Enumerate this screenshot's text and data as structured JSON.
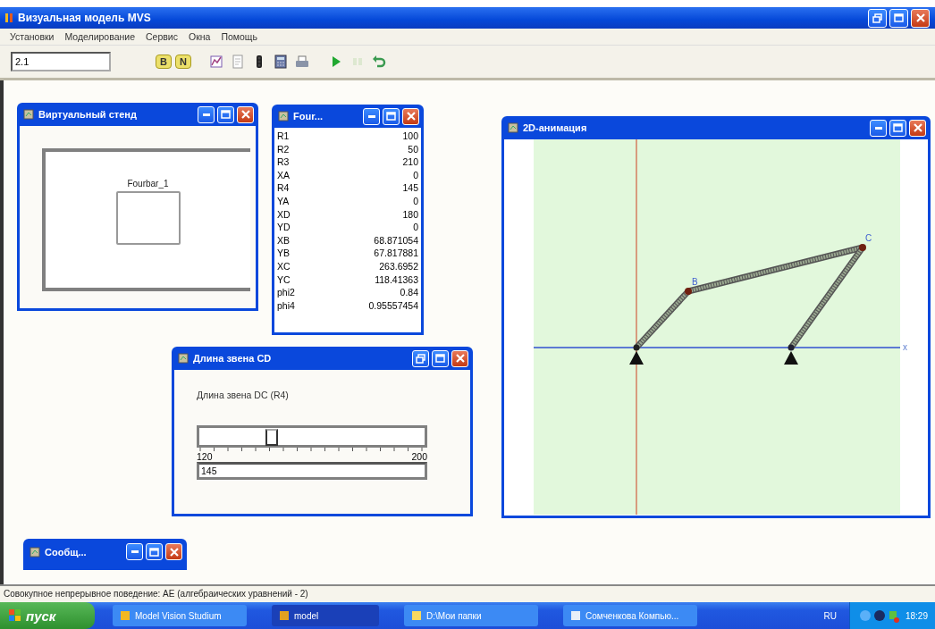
{
  "window": {
    "title": "Визуальная модель MVS"
  },
  "menu": [
    "Установки",
    "Моделирование",
    "Сервис",
    "Окна",
    "Помощь"
  ],
  "toolbar": {
    "value": "2.1",
    "mode_buttons": [
      "B",
      "N"
    ]
  },
  "windows": [
    {
      "kind": "stand",
      "title": "Виртуальный стенд",
      "block_label": "Fourbar_1"
    },
    {
      "kind": "variables",
      "title": "Four...",
      "rows": [
        {
          "name": "R1",
          "value": "100"
        },
        {
          "name": "R2",
          "value": "50"
        },
        {
          "name": "R3",
          "value": "210"
        },
        {
          "name": "XA",
          "value": "0"
        },
        {
          "name": "R4",
          "value": "145"
        },
        {
          "name": "YA",
          "value": "0"
        },
        {
          "name": "XD",
          "value": "180"
        },
        {
          "name": "YD",
          "value": "0"
        },
        {
          "name": "XB",
          "value": "68.871054"
        },
        {
          "name": "YB",
          "value": "67.817881"
        },
        {
          "name": "XC",
          "value": "263.6952"
        },
        {
          "name": "YC",
          "value": "118.41363"
        },
        {
          "name": "phi2",
          "value": "0.84"
        },
        {
          "name": "phi4",
          "value": "0.95557454"
        }
      ]
    },
    {
      "kind": "slider",
      "title": "Длина звена CD",
      "label": "Длина звена DC (R4)",
      "min": "120",
      "max": "200",
      "level": 0.3125,
      "value": "145"
    },
    {
      "kind": "animation",
      "title": "2D-анимация",
      "points": [
        "B",
        "C"
      ],
      "axis_label": "x"
    },
    {
      "kind": "minimized",
      "title": "Сообщ..."
    }
  ],
  "status_bar": "Совокупное непрерывное поведение: AE (алгебраических уравнений - 2)",
  "taskbar": {
    "start": "пуск",
    "items": [
      {
        "label": "Model Vision Studium",
        "selected": false
      },
      {
        "label": "model",
        "selected": true
      },
      {
        "label": "D:\\Мои папки",
        "selected": false
      },
      {
        "label": "Сомченкова Компью...",
        "selected": false
      }
    ],
    "language": "RU",
    "clock": "18:29"
  }
}
